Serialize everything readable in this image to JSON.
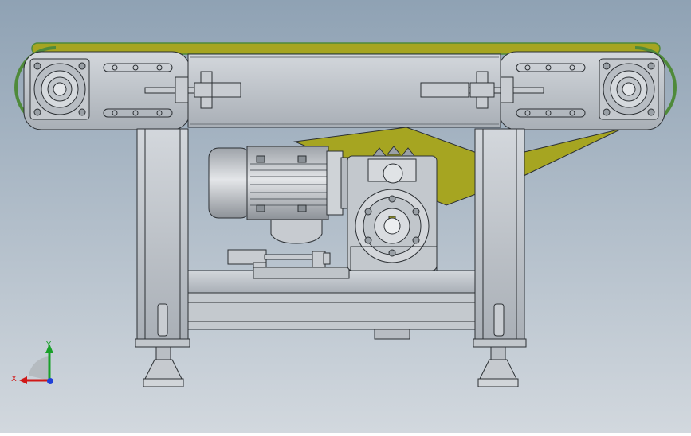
{
  "viewport": {
    "background_top": "#8fa2b4",
    "background_bottom": "#d2d8de",
    "part_fill": "#bcc1c7",
    "part_stroke": "#2b2f33",
    "belt_color": "#a6a521",
    "belt_edge": "#4f8a3a"
  },
  "triad": {
    "x_label": "X",
    "y_label": "Y",
    "x_color": "#d01818",
    "y_color": "#18a028",
    "z_color": "#2040d8"
  }
}
